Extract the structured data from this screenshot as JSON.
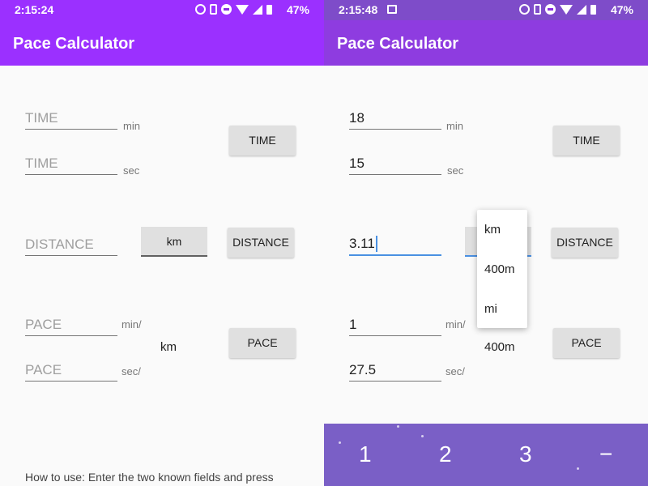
{
  "colors": {
    "left_appbar": "#9b30ff",
    "right_appbar": "#8e3ce0",
    "accent": "#4a90e2",
    "keyboard": "#7a5fc6"
  },
  "left": {
    "status": {
      "time": "2:15:24",
      "battery": "47%"
    },
    "title": "Pace Calculator",
    "time_min": {
      "placeholder": "TIME",
      "unit": "min"
    },
    "time_sec": {
      "placeholder": "TIME",
      "unit": "sec"
    },
    "time_button": "TIME",
    "distance": {
      "placeholder": "DISTANCE"
    },
    "distance_unit_selected": "km",
    "distance_button": "DISTANCE",
    "pace_min": {
      "placeholder": "PACE",
      "unit": "min/"
    },
    "pace_sec": {
      "placeholder": "PACE",
      "unit": "sec/"
    },
    "pace_unit": "km",
    "pace_button": "PACE",
    "help": "How to use: Enter the two known fields and press"
  },
  "right": {
    "status": {
      "time": "2:15:48",
      "battery": "47%"
    },
    "title": "Pace Calculator",
    "time_min": {
      "value": "18",
      "unit": "min"
    },
    "time_sec": {
      "value": "15",
      "unit": "sec"
    },
    "time_button": "TIME",
    "distance": {
      "value": "3.11"
    },
    "distance_button": "DISTANCE",
    "dropdown_options": [
      "km",
      "400m",
      "mi"
    ],
    "pace_min": {
      "value": "1",
      "unit": "min/"
    },
    "pace_sec": {
      "value": "27.5",
      "unit": "sec/"
    },
    "pace_unit": "400m",
    "pace_button": "PACE",
    "keyboard_keys": [
      "1",
      "2",
      "3",
      "−"
    ]
  }
}
